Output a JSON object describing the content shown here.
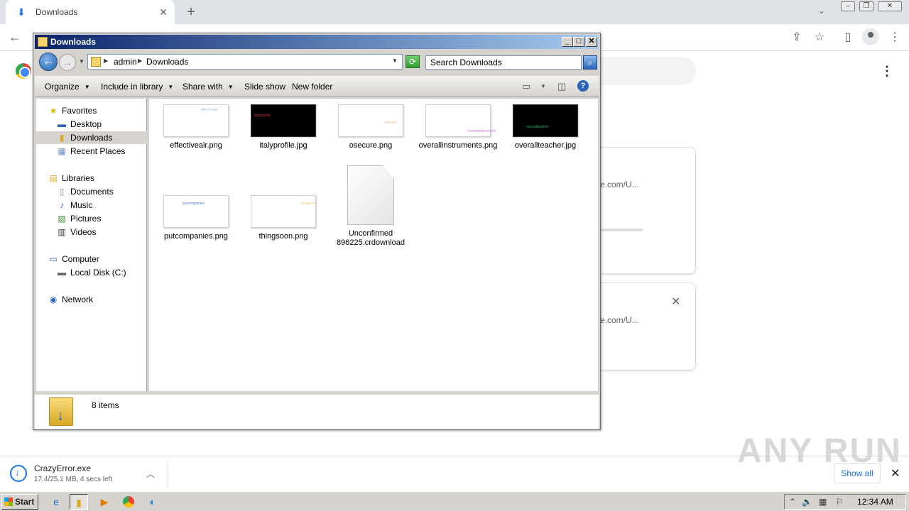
{
  "browser": {
    "tab_title": "Downloads",
    "tab_icon": "download-icon",
    "url_fragments": [
      "e.com/U...",
      "e.com/U..."
    ]
  },
  "explorer": {
    "title": "Downloads",
    "breadcrumb": [
      "admin",
      "Downloads"
    ],
    "search_placeholder": "Search Downloads",
    "commands": [
      {
        "label": "Organize",
        "has_menu": true
      },
      {
        "label": "Include in library",
        "has_menu": true
      },
      {
        "label": "Share with",
        "has_menu": true
      },
      {
        "label": "Slide show",
        "has_menu": false
      },
      {
        "label": "New folder",
        "has_menu": false
      }
    ],
    "nav": {
      "favorites": {
        "label": "Favorites",
        "items": [
          "Desktop",
          "Downloads",
          "Recent Places"
        ]
      },
      "libraries": {
        "label": "Libraries",
        "items": [
          "Documents",
          "Music",
          "Pictures",
          "Videos"
        ]
      },
      "computer": {
        "label": "Computer",
        "items": [
          "Local Disk (C:)"
        ]
      },
      "network": {
        "label": "Network"
      }
    },
    "selected_nav": "Downloads",
    "files": [
      {
        "name": "effectiveair.png",
        "thumb": "light",
        "thumb_text": "effectiveair",
        "thumb_color": "#9ec3e6"
      },
      {
        "name": "italyprofile.jpg",
        "thumb": "dark",
        "thumb_text": "italyprofile",
        "thumb_color": "#c0392b"
      },
      {
        "name": "osecure.png",
        "thumb": "light",
        "thumb_text": "osecure",
        "thumb_color": "#f0b37e"
      },
      {
        "name": "overallinstruments.png",
        "thumb": "light",
        "thumb_text": "overallinstruments",
        "thumb_color": "#c77dd8"
      },
      {
        "name": "overallteacher.jpg",
        "thumb": "dark",
        "thumb_text": "overallteacher",
        "thumb_color": "#27ae60"
      },
      {
        "name": "putcompanies.png",
        "thumb": "light",
        "thumb_text": "putcompanies",
        "thumb_color": "#4a7fc1"
      },
      {
        "name": "thingsoon.png",
        "thumb": "light",
        "thumb_text": "thingsoon",
        "thumb_color": "#e6d36b"
      },
      {
        "name": "Unconfirmed 896225.crdownload",
        "thumb": "document",
        "thumb_text": "",
        "thumb_color": ""
      }
    ],
    "status": "8 items"
  },
  "download_shelf": {
    "file_name": "CrazyError.exe",
    "status": "17.4/25.1 MB, 4 secs left",
    "show_all_label": "Show all"
  },
  "watermark": "ANY RUN",
  "taskbar": {
    "start_label": "Start",
    "apps": [
      "internet-explorer-icon",
      "folder-icon",
      "media-player-icon",
      "chrome-icon",
      "edge-icon"
    ],
    "clock": "12:34 AM"
  }
}
